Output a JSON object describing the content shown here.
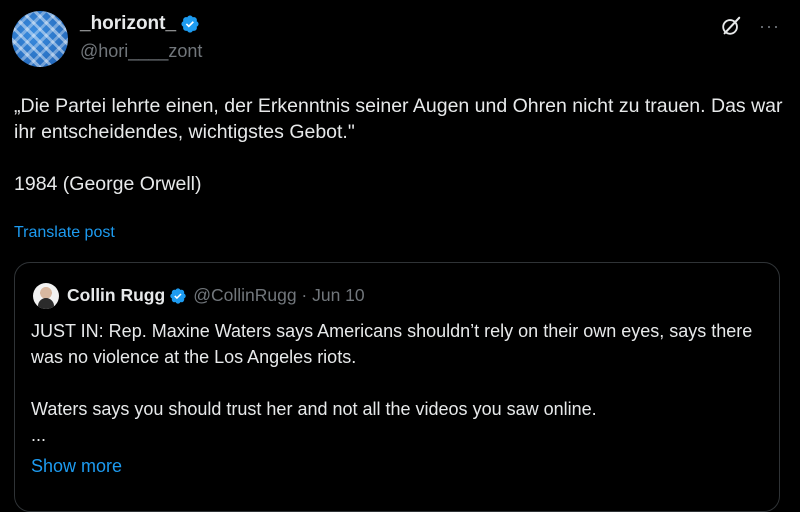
{
  "author": {
    "display_name": "_horizont_",
    "handle": "@hori____zont"
  },
  "post": {
    "text": "„Die Partei lehrte einen, der Erkenntnis seiner Augen und Ohren nicht zu trauen. Das war ihr entscheidendes, wichtigstes Gebot.\"\n\n1984 (George Orwell)",
    "translate_label": "Translate post"
  },
  "quoted": {
    "display_name": "Collin Rugg",
    "meta": "@CollinRugg · Jun 10",
    "text": "JUST IN: Rep. Maxine Waters says Americans shouldn’t rely on their own eyes, says there was no violence at the Los Angeles riots.\n\nWaters says you should trust her and not all the videos you saw online.\n...",
    "show_more_label": "Show more"
  },
  "icons": {
    "verified": "verified-badge-icon",
    "grok": "grok-icon",
    "more": "more-options-icon"
  },
  "colors": {
    "accent": "#1d9bf0",
    "text": "#e7e9ea",
    "muted": "#71767b",
    "border": "#2f3336",
    "background": "#000000"
  }
}
